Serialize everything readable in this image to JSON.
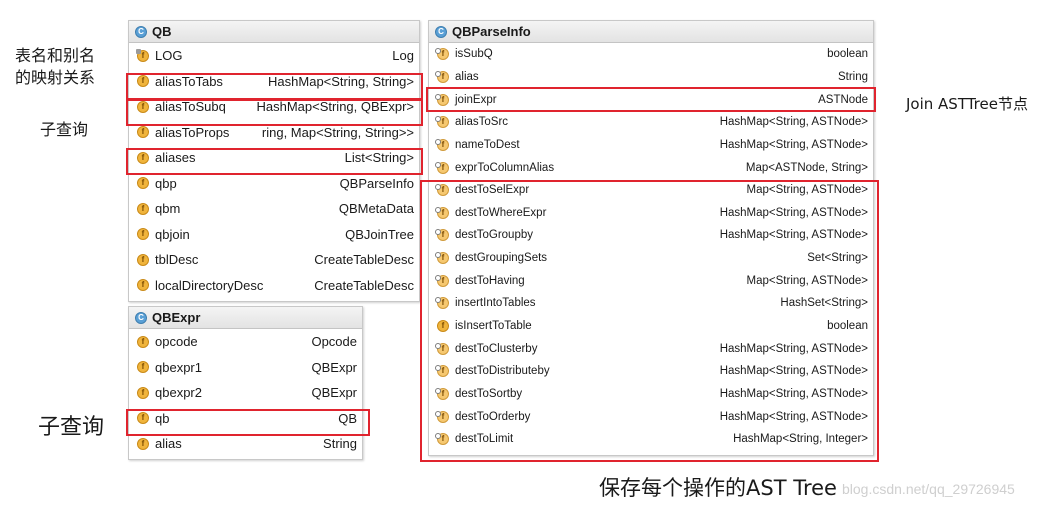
{
  "annotations": {
    "alias_map_line1": "表名和别名",
    "alias_map_line2": "的映射关系",
    "subquery_top": "子查询",
    "subquery_bottom": "子查询",
    "join_node": "Join ASTTree节点",
    "save_ast": "保存每个操作的AST Tree",
    "watermark": "blog.csdn.net/qq_29726945"
  },
  "qb_panel": {
    "title": "QB",
    "title_icon": "class-icon",
    "fields": [
      {
        "icon": "static-field-icon",
        "name": "LOG",
        "type": "Log"
      },
      {
        "icon": "field-icon",
        "name": "aliasToTabs",
        "type": "HashMap<String, String>"
      },
      {
        "icon": "field-icon",
        "name": "aliasToSubq",
        "type": "HashMap<String, QBExpr>"
      },
      {
        "icon": "field-icon",
        "name": "aliasToProps",
        "type": "ring, Map<String, String>>"
      },
      {
        "icon": "field-icon",
        "name": "aliases",
        "type": "List<String>"
      },
      {
        "icon": "field-icon",
        "name": "qbp",
        "type": "QBParseInfo"
      },
      {
        "icon": "field-icon",
        "name": "qbm",
        "type": "QBMetaData"
      },
      {
        "icon": "field-icon",
        "name": "qbjoin",
        "type": "QBJoinTree"
      },
      {
        "icon": "field-icon",
        "name": "tblDesc",
        "type": "CreateTableDesc"
      },
      {
        "icon": "field-icon",
        "name": "localDirectoryDesc",
        "type": "CreateTableDesc"
      }
    ]
  },
  "qbexpr_panel": {
    "title": "QBExpr",
    "title_icon": "class-icon",
    "fields": [
      {
        "icon": "field-icon",
        "name": "opcode",
        "type": "Opcode"
      },
      {
        "icon": "field-icon",
        "name": "qbexpr1",
        "type": "QBExpr"
      },
      {
        "icon": "field-icon",
        "name": "qbexpr2",
        "type": "QBExpr"
      },
      {
        "icon": "field-icon",
        "name": "qb",
        "type": "QB"
      },
      {
        "icon": "field-icon",
        "name": "alias",
        "type": "String"
      }
    ]
  },
  "qbparse_panel": {
    "title": "QBParseInfo",
    "title_icon": "class-icon",
    "fields": [
      {
        "icon": "local-field-icon",
        "name": "isSubQ",
        "type": "boolean"
      },
      {
        "icon": "local-field-icon",
        "name": "alias",
        "type": "String"
      },
      {
        "icon": "local-field-icon",
        "name": "joinExpr",
        "type": "ASTNode"
      },
      {
        "icon": "local-field-icon",
        "name": "aliasToSrc",
        "type": "HashMap<String, ASTNode>"
      },
      {
        "icon": "local-field-icon",
        "name": "nameToDest",
        "type": "HashMap<String, ASTNode>"
      },
      {
        "icon": "local-field-icon",
        "name": "exprToColumnAlias",
        "type": "Map<ASTNode, String>"
      },
      {
        "icon": "local-field-icon",
        "name": "destToSelExpr",
        "type": "Map<String, ASTNode>"
      },
      {
        "icon": "local-field-icon",
        "name": "destToWhereExpr",
        "type": "HashMap<String, ASTNode>"
      },
      {
        "icon": "local-field-icon",
        "name": "destToGroupby",
        "type": "HashMap<String, ASTNode>"
      },
      {
        "icon": "local-field-icon",
        "name": "destGroupingSets",
        "type": "Set<String>"
      },
      {
        "icon": "local-field-icon",
        "name": "destToHaving",
        "type": "Map<String, ASTNode>"
      },
      {
        "icon": "local-field-icon",
        "name": "insertIntoTables",
        "type": "HashSet<String>"
      },
      {
        "icon": "field-icon",
        "name": "isInsertToTable",
        "type": "boolean"
      },
      {
        "icon": "local-field-icon",
        "name": "destToClusterby",
        "type": "HashMap<String, ASTNode>"
      },
      {
        "icon": "local-field-icon",
        "name": "destToDistributeby",
        "type": "HashMap<String, ASTNode>"
      },
      {
        "icon": "local-field-icon",
        "name": "destToSortby",
        "type": "HashMap<String, ASTNode>"
      },
      {
        "icon": "local-field-icon",
        "name": "destToOrderby",
        "type": "HashMap<String, ASTNode>"
      },
      {
        "icon": "local-field-icon",
        "name": "destToLimit",
        "type": "HashMap<String, Integer>"
      }
    ]
  },
  "colors": {
    "highlight_border": "#e0242e",
    "field_icon": "#f0b43c",
    "class_icon": "#5aa0d6"
  }
}
